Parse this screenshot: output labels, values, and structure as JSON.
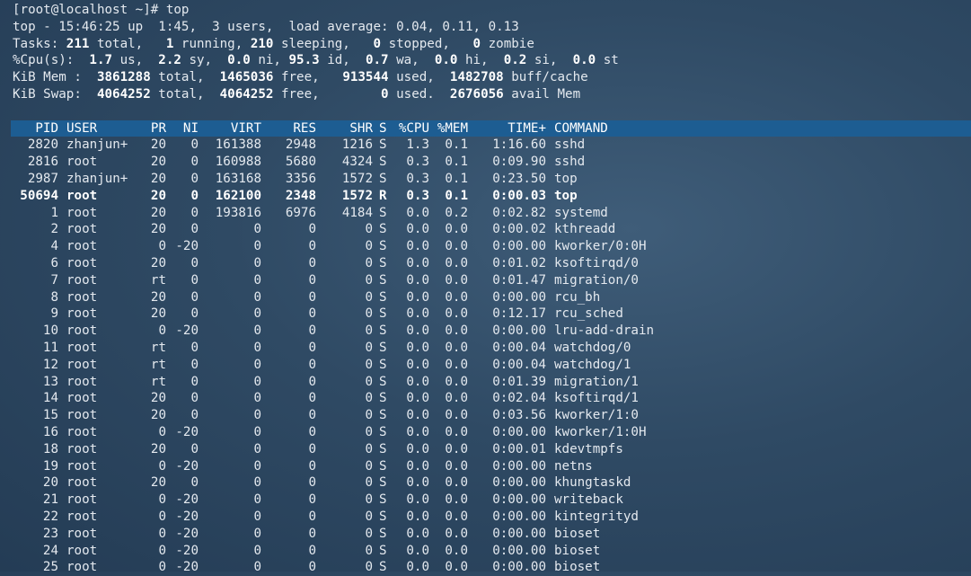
{
  "summary": {
    "prompt": "[root@localhost ~]# top",
    "uptime": "top - 15:46:25 up  1:45,  3 users,  load average: 0.04, 0.11, 0.13",
    "tasks": {
      "label": "Tasks: ",
      "total": "211",
      "t1": " total,   ",
      "running": "1",
      "t2": " running, ",
      "sleeping": "210",
      "t3": " sleeping,   ",
      "stopped": "0",
      "t4": " stopped,   ",
      "zombie": "0",
      "t5": " zombie"
    },
    "cpu": {
      "label": "%Cpu(s):  ",
      "us": "1.7",
      "t1": " us,  ",
      "sy": "2.2",
      "t2": " sy,  ",
      "ni": "0.0",
      "t3": " ni, ",
      "id": "95.3",
      "t4": " id,  ",
      "wa": "0.7",
      "t5": " wa,  ",
      "hi": "0.0",
      "t6": " hi,  ",
      "si": "0.2",
      "t7": " si,  ",
      "st": "0.0",
      "t8": " st"
    },
    "mem": {
      "label": "KiB Mem :  ",
      "total": "3861288",
      "t1": " total,  ",
      "free": "1465036",
      "t2": " free,   ",
      "used": "913544",
      "t3": " used,  ",
      "cache": "1482708",
      "t4": " buff/cache"
    },
    "swap": {
      "label": "KiB Swap:  ",
      "total": "4064252",
      "t1": " total,  ",
      "free": "4064252",
      "t2": " free,        ",
      "used": "0",
      "t3": " used.  ",
      "avail": "2676056",
      "t4": " avail Mem"
    }
  },
  "columns": [
    "PID",
    "USER",
    "PR",
    "NI",
    "VIRT",
    "RES",
    "SHR",
    "S",
    "%CPU",
    "%MEM",
    "TIME+",
    "COMMAND"
  ],
  "processes": [
    [
      "2820",
      "zhanjun+",
      "20",
      "0",
      "161388",
      "2948",
      "1216",
      "S",
      "1.3",
      "0.1",
      "1:16.60",
      "sshd"
    ],
    [
      "2816",
      "root",
      "20",
      "0",
      "160988",
      "5680",
      "4324",
      "S",
      "0.3",
      "0.1",
      "0:09.90",
      "sshd"
    ],
    [
      "2987",
      "zhanjun+",
      "20",
      "0",
      "163168",
      "3356",
      "1572",
      "S",
      "0.3",
      "0.1",
      "0:23.50",
      "top"
    ],
    [
      "50694",
      "root",
      "20",
      "0",
      "162100",
      "2348",
      "1572",
      "R",
      "0.3",
      "0.1",
      "0:00.03",
      "top"
    ],
    [
      "1",
      "root",
      "20",
      "0",
      "193816",
      "6976",
      "4184",
      "S",
      "0.0",
      "0.2",
      "0:02.82",
      "systemd"
    ],
    [
      "2",
      "root",
      "20",
      "0",
      "0",
      "0",
      "0",
      "S",
      "0.0",
      "0.0",
      "0:00.02",
      "kthreadd"
    ],
    [
      "4",
      "root",
      "0",
      "-20",
      "0",
      "0",
      "0",
      "S",
      "0.0",
      "0.0",
      "0:00.00",
      "kworker/0:0H"
    ],
    [
      "6",
      "root",
      "20",
      "0",
      "0",
      "0",
      "0",
      "S",
      "0.0",
      "0.0",
      "0:01.02",
      "ksoftirqd/0"
    ],
    [
      "7",
      "root",
      "rt",
      "0",
      "0",
      "0",
      "0",
      "S",
      "0.0",
      "0.0",
      "0:01.47",
      "migration/0"
    ],
    [
      "8",
      "root",
      "20",
      "0",
      "0",
      "0",
      "0",
      "S",
      "0.0",
      "0.0",
      "0:00.00",
      "rcu_bh"
    ],
    [
      "9",
      "root",
      "20",
      "0",
      "0",
      "0",
      "0",
      "S",
      "0.0",
      "0.0",
      "0:12.17",
      "rcu_sched"
    ],
    [
      "10",
      "root",
      "0",
      "-20",
      "0",
      "0",
      "0",
      "S",
      "0.0",
      "0.0",
      "0:00.00",
      "lru-add-drain"
    ],
    [
      "11",
      "root",
      "rt",
      "0",
      "0",
      "0",
      "0",
      "S",
      "0.0",
      "0.0",
      "0:00.04",
      "watchdog/0"
    ],
    [
      "12",
      "root",
      "rt",
      "0",
      "0",
      "0",
      "0",
      "S",
      "0.0",
      "0.0",
      "0:00.04",
      "watchdog/1"
    ],
    [
      "13",
      "root",
      "rt",
      "0",
      "0",
      "0",
      "0",
      "S",
      "0.0",
      "0.0",
      "0:01.39",
      "migration/1"
    ],
    [
      "14",
      "root",
      "20",
      "0",
      "0",
      "0",
      "0",
      "S",
      "0.0",
      "0.0",
      "0:02.04",
      "ksoftirqd/1"
    ],
    [
      "15",
      "root",
      "20",
      "0",
      "0",
      "0",
      "0",
      "S",
      "0.0",
      "0.0",
      "0:03.56",
      "kworker/1:0"
    ],
    [
      "16",
      "root",
      "0",
      "-20",
      "0",
      "0",
      "0",
      "S",
      "0.0",
      "0.0",
      "0:00.00",
      "kworker/1:0H"
    ],
    [
      "18",
      "root",
      "20",
      "0",
      "0",
      "0",
      "0",
      "S",
      "0.0",
      "0.0",
      "0:00.01",
      "kdevtmpfs"
    ],
    [
      "19",
      "root",
      "0",
      "-20",
      "0",
      "0",
      "0",
      "S",
      "0.0",
      "0.0",
      "0:00.00",
      "netns"
    ],
    [
      "20",
      "root",
      "20",
      "0",
      "0",
      "0",
      "0",
      "S",
      "0.0",
      "0.0",
      "0:00.00",
      "khungtaskd"
    ],
    [
      "21",
      "root",
      "0",
      "-20",
      "0",
      "0",
      "0",
      "S",
      "0.0",
      "0.0",
      "0:00.00",
      "writeback"
    ],
    [
      "22",
      "root",
      "0",
      "-20",
      "0",
      "0",
      "0",
      "S",
      "0.0",
      "0.0",
      "0:00.00",
      "kintegrityd"
    ],
    [
      "23",
      "root",
      "0",
      "-20",
      "0",
      "0",
      "0",
      "S",
      "0.0",
      "0.0",
      "0:00.00",
      "bioset"
    ],
    [
      "24",
      "root",
      "0",
      "-20",
      "0",
      "0",
      "0",
      "S",
      "0.0",
      "0.0",
      "0:00.00",
      "bioset"
    ],
    [
      "25",
      "root",
      "0",
      "-20",
      "0",
      "0",
      "0",
      "S",
      "0.0",
      "0.0",
      "0:00.00",
      "bioset"
    ]
  ],
  "highlight_pid": "50694"
}
